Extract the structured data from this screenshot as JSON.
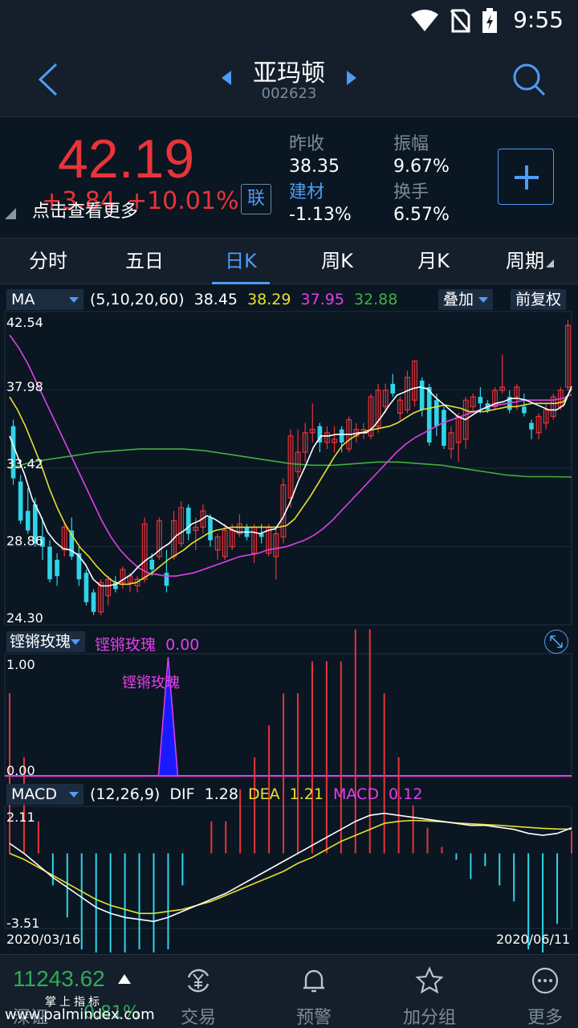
{
  "status": {
    "time": "9:55"
  },
  "header": {
    "stock_name": "亚玛顿",
    "stock_code": "002623"
  },
  "quote": {
    "price": "42.19",
    "change": "+3.84",
    "change_pct": "+10.01%",
    "more_tip": "点击查看更多",
    "lian": "联",
    "prev_close_label": "昨收",
    "prev_close": "38.35",
    "amplitude_label": "振幅",
    "amplitude": "9.67%",
    "sector_label": "建材",
    "sector_change": "-1.13%",
    "turnover_label": "换手",
    "turnover": "6.57%"
  },
  "tabs": [
    {
      "label": "分时"
    },
    {
      "label": "五日"
    },
    {
      "label": "日K"
    },
    {
      "label": "周K"
    },
    {
      "label": "月K"
    },
    {
      "label": "周期"
    }
  ],
  "main_indicator": {
    "name": "MA",
    "params": "(5,10,20,60)",
    "ma5": "38.45",
    "ma10": "38.29",
    "ma20": "37.95",
    "ma60": "32.88",
    "overlay_btn": "叠加",
    "adjust_btn": "前复权",
    "y_labels": [
      "42.54",
      "37.98",
      "33.42",
      "28.86",
      "24.30"
    ]
  },
  "sub1": {
    "name": "铿锵玫瑰",
    "value_label": "铿锵玫瑰",
    "value": "0.00",
    "annotation": "铿锵玫瑰",
    "y_top": "1.00",
    "y_bottom": "0.00"
  },
  "sub2": {
    "name": "MACD",
    "params": "(12,26,9)",
    "dif_label": "DIF",
    "dif": "1.28",
    "dea_label": "DEA",
    "dea": "1.21",
    "macd_label": "MACD",
    "macd": "0.12",
    "y_top": "2.11",
    "y_bottom": "-3.51",
    "date_start": "2020/03/16",
    "date_end": "2020/06/11"
  },
  "colors": {
    "up": "#e8343a",
    "down": "#2fd4e8",
    "accent": "#4e9cf4",
    "ma5": "#ffffff",
    "ma10": "#e8e030",
    "ma20": "#e040e8",
    "ma60": "#40b040"
  },
  "bottom": {
    "index_value": "11243.62",
    "index_name": "深证",
    "index_pct": "0.81%",
    "watermark_cn": "掌上指标",
    "watermark": "www.palmindex.com",
    "nav": [
      {
        "label": "交易",
        "icon": "trade-icon"
      },
      {
        "label": "预警",
        "icon": "bell-icon"
      },
      {
        "label": "加分组",
        "icon": "star-icon"
      },
      {
        "label": "更多",
        "icon": "more-icon"
      }
    ]
  },
  "chart_data": {
    "type": "candlestick",
    "ylim": [
      24.3,
      42.54
    ],
    "x_start": "2020/03/16",
    "x_end": "2020/06/11",
    "ohlc": [
      [
        36.0,
        36.4,
        32.4,
        32.8
      ],
      [
        32.6,
        33.0,
        30.0,
        30.2
      ],
      [
        30.8,
        32.2,
        29.4,
        29.6
      ],
      [
        31.2,
        31.6,
        28.6,
        28.8
      ],
      [
        29.2,
        30.4,
        27.8,
        28.6
      ],
      [
        28.6,
        29.0,
        26.4,
        26.6
      ],
      [
        27.8,
        28.2,
        26.2,
        26.8
      ],
      [
        28.4,
        30.0,
        28.0,
        29.8
      ],
      [
        29.6,
        30.4,
        27.8,
        28.0
      ],
      [
        28.2,
        28.6,
        26.2,
        26.6
      ],
      [
        27.0,
        27.2,
        25.0,
        25.2
      ],
      [
        25.8,
        26.0,
        24.4,
        24.6
      ],
      [
        24.6,
        26.6,
        24.4,
        26.4
      ],
      [
        25.6,
        26.8,
        25.0,
        26.6
      ],
      [
        26.4,
        26.8,
        25.8,
        26.0
      ],
      [
        26.4,
        27.4,
        26.0,
        27.2
      ],
      [
        26.4,
        27.0,
        25.8,
        26.8
      ],
      [
        26.2,
        26.8,
        25.8,
        26.6
      ],
      [
        26.6,
        30.4,
        26.4,
        30.0
      ],
      [
        27.8,
        28.2,
        26.8,
        27.2
      ],
      [
        28.0,
        30.4,
        27.8,
        30.2
      ],
      [
        27.0,
        28.4,
        25.8,
        26.2
      ],
      [
        28.0,
        30.8,
        27.8,
        30.2
      ],
      [
        28.8,
        31.4,
        28.6,
        31.0
      ],
      [
        31.0,
        31.2,
        29.0,
        29.4
      ],
      [
        29.6,
        30.4,
        28.4,
        29.8
      ],
      [
        29.8,
        31.2,
        29.4,
        30.8
      ],
      [
        30.4,
        30.6,
        28.6,
        29.0
      ],
      [
        28.4,
        29.4,
        27.8,
        29.2
      ],
      [
        28.0,
        30.0,
        27.8,
        29.6
      ],
      [
        28.6,
        30.0,
        28.4,
        29.6
      ],
      [
        29.4,
        30.6,
        29.2,
        30.0
      ],
      [
        29.8,
        30.0,
        29.0,
        29.2
      ],
      [
        28.2,
        30.0,
        27.6,
        29.8
      ],
      [
        29.4,
        30.0,
        28.8,
        29.2
      ],
      [
        28.2,
        30.0,
        28.0,
        29.8
      ],
      [
        28.0,
        29.8,
        26.6,
        29.4
      ],
      [
        29.2,
        32.8,
        28.8,
        32.4
      ],
      [
        31.6,
        35.8,
        31.0,
        35.4
      ],
      [
        33.2,
        35.8,
        32.8,
        34.4
      ],
      [
        34.4,
        36.2,
        33.8,
        35.6
      ],
      [
        35.6,
        37.4,
        35.0,
        35.8
      ],
      [
        36.0,
        36.2,
        34.4,
        35.0
      ],
      [
        35.0,
        36.0,
        34.6,
        35.6
      ],
      [
        35.0,
        36.0,
        34.4,
        35.2
      ],
      [
        35.8,
        36.0,
        34.4,
        35.0
      ],
      [
        34.6,
        36.6,
        34.4,
        36.4
      ],
      [
        35.4,
        36.2,
        35.0,
        35.8
      ],
      [
        35.6,
        36.2,
        35.2,
        35.8
      ],
      [
        35.4,
        38.0,
        35.2,
        37.8
      ],
      [
        36.0,
        38.6,
        35.6,
        38.2
      ],
      [
        37.2,
        38.6,
        36.8,
        38.2
      ],
      [
        38.6,
        39.2,
        37.8,
        38.0
      ],
      [
        36.8,
        37.8,
        36.4,
        37.6
      ],
      [
        37.0,
        39.4,
        36.8,
        39.0
      ],
      [
        37.6,
        40.0,
        37.2,
        40.0
      ],
      [
        38.8,
        39.0,
        36.6,
        37.0
      ],
      [
        38.4,
        38.6,
        34.8,
        35.0
      ],
      [
        37.6,
        38.0,
        35.4,
        36.0
      ],
      [
        37.0,
        37.2,
        34.6,
        34.8
      ],
      [
        34.6,
        36.0,
        34.0,
        35.6
      ],
      [
        35.0,
        36.8,
        33.8,
        36.6
      ],
      [
        35.2,
        37.8,
        34.6,
        37.6
      ],
      [
        37.2,
        38.0,
        36.8,
        37.8
      ],
      [
        37.8,
        38.4,
        36.8,
        37.4
      ],
      [
        37.4,
        37.6,
        36.8,
        37.0
      ],
      [
        37.2,
        38.4,
        37.0,
        38.2
      ],
      [
        38.2,
        40.4,
        38.0,
        38.4
      ],
      [
        37.8,
        38.2,
        36.8,
        37.0
      ],
      [
        37.8,
        38.6,
        37.0,
        38.4
      ],
      [
        37.2,
        38.0,
        36.6,
        36.8
      ],
      [
        36.2,
        36.4,
        35.2,
        35.8
      ],
      [
        35.6,
        36.8,
        35.2,
        36.6
      ],
      [
        36.2,
        37.4,
        35.8,
        37.0
      ],
      [
        36.6,
        38.0,
        36.4,
        37.8
      ],
      [
        37.2,
        38.4,
        37.0,
        38.2
      ],
      [
        38.4,
        42.54,
        38.2,
        42.19
      ]
    ],
    "ma5": [
      35.4,
      34.2,
      33.0,
      31.5,
      30.6,
      29.5,
      28.9,
      28.5,
      28.4,
      28.1,
      27.5,
      26.6,
      26.2,
      26.2,
      26.3,
      26.6,
      26.9,
      27.4,
      27.8,
      28.1,
      28.5,
      28.8,
      29.3,
      29.6,
      30.0,
      30.2,
      30.5,
      30.3,
      30.0,
      29.7,
      29.5,
      29.5,
      29.5,
      29.4,
      29.6,
      29.7,
      30.4,
      31.4,
      32.6,
      33.6,
      34.7,
      35.4,
      35.4,
      35.5,
      35.5,
      35.5,
      35.6,
      35.6,
      36.0,
      36.6,
      37.3,
      37.9,
      38.1,
      38.3,
      38.4,
      38.3,
      37.8,
      37.4,
      37.0,
      36.6,
      36.4,
      36.7,
      37.0,
      37.2,
      37.4,
      37.5,
      37.7,
      37.7,
      37.6,
      37.4,
      37.2,
      37.0,
      37.0,
      37.3,
      38.45
    ],
    "ma10": [
      37.8,
      37.0,
      36.0,
      34.8,
      33.6,
      32.2,
      31.0,
      30.0,
      29.2,
      28.5,
      28.0,
      27.4,
      26.9,
      26.5,
      26.3,
      26.3,
      26.4,
      26.7,
      27.0,
      27.4,
      27.8,
      28.1,
      28.4,
      28.8,
      29.1,
      29.4,
      29.6,
      29.7,
      29.8,
      29.8,
      29.8,
      29.8,
      29.8,
      29.8,
      29.8,
      29.9,
      30.3,
      31.0,
      31.7,
      32.5,
      33.3,
      34.1,
      34.8,
      35.2,
      35.5,
      35.7,
      35.8,
      35.9,
      36.0,
      36.2,
      36.5,
      36.8,
      37.0,
      37.1,
      37.2,
      37.3,
      37.2,
      37.1,
      36.9,
      36.9,
      36.9,
      37.0,
      37.1,
      37.2,
      37.2,
      37.3,
      37.4,
      37.4,
      37.4,
      37.4,
      37.5,
      38.29
    ],
    "ma20": [
      41.6,
      40.8,
      39.8,
      38.6,
      37.4,
      36.2,
      35.0,
      33.8,
      32.6,
      31.4,
      30.2,
      29.2,
      28.4,
      27.8,
      27.3,
      27.0,
      26.9,
      26.8,
      26.8,
      26.9,
      27.0,
      27.2,
      27.4,
      27.6,
      27.8,
      28.0,
      28.1,
      28.2,
      28.4,
      28.5,
      28.6,
      28.8,
      29.0,
      29.3,
      29.7,
      30.2,
      30.8,
      31.4,
      32.0,
      32.6,
      33.2,
      33.8,
      34.4,
      34.9,
      35.3,
      35.6,
      35.9,
      36.2,
      36.4,
      36.6,
      36.8,
      37.0,
      37.2,
      37.3,
      37.4,
      37.5,
      37.6,
      37.6,
      37.6,
      37.6,
      37.7,
      37.95
    ],
    "ma60": [
      33.4,
      33.8,
      34.0,
      34.2,
      34.4,
      34.5,
      34.6,
      34.6,
      34.6,
      34.5,
      34.3,
      34.1,
      33.9,
      33.7,
      33.6,
      33.6,
      33.7,
      33.8,
      33.8,
      33.7,
      33.6,
      33.4,
      33.2,
      33.0,
      32.9,
      32.9,
      32.88
    ],
    "macd_dif": [
      0.5,
      0.0,
      -0.6,
      -1.2,
      -1.7,
      -2.2,
      -2.7,
      -3.0,
      -3.2,
      -3.3,
      -3.4,
      -3.2,
      -2.9,
      -2.6,
      -2.3,
      -2.0,
      -1.6,
      -1.2,
      -0.8,
      -0.4,
      0.0,
      0.4,
      0.8,
      1.2,
      1.6,
      1.9,
      2.0,
      1.9,
      1.8,
      1.7,
      1.6,
      1.5,
      1.4,
      1.4,
      1.3,
      1.2,
      1.0,
      0.9,
      1.0,
      1.28
    ],
    "macd_dea": [
      0.0,
      -0.3,
      -0.7,
      -1.1,
      -1.5,
      -1.9,
      -2.3,
      -2.6,
      -2.8,
      -3.0,
      -3.0,
      -2.9,
      -2.8,
      -2.6,
      -2.4,
      -2.1,
      -1.8,
      -1.5,
      -1.2,
      -0.9,
      -0.5,
      -0.2,
      0.2,
      0.6,
      0.9,
      1.2,
      1.5,
      1.6,
      1.65,
      1.62,
      1.58,
      1.52,
      1.48,
      1.44,
      1.4,
      1.35,
      1.3,
      1.25,
      1.22,
      1.21
    ],
    "sub1_signal": [
      0,
      0,
      0,
      0,
      0,
      0,
      0,
      0,
      0,
      0,
      0,
      1,
      0,
      0,
      0,
      0,
      0,
      0,
      0,
      0,
      0,
      0,
      0,
      0,
      0,
      0,
      0,
      0,
      0,
      0,
      0,
      0,
      0,
      0,
      0,
      0,
      0,
      0,
      0,
      0
    ]
  }
}
